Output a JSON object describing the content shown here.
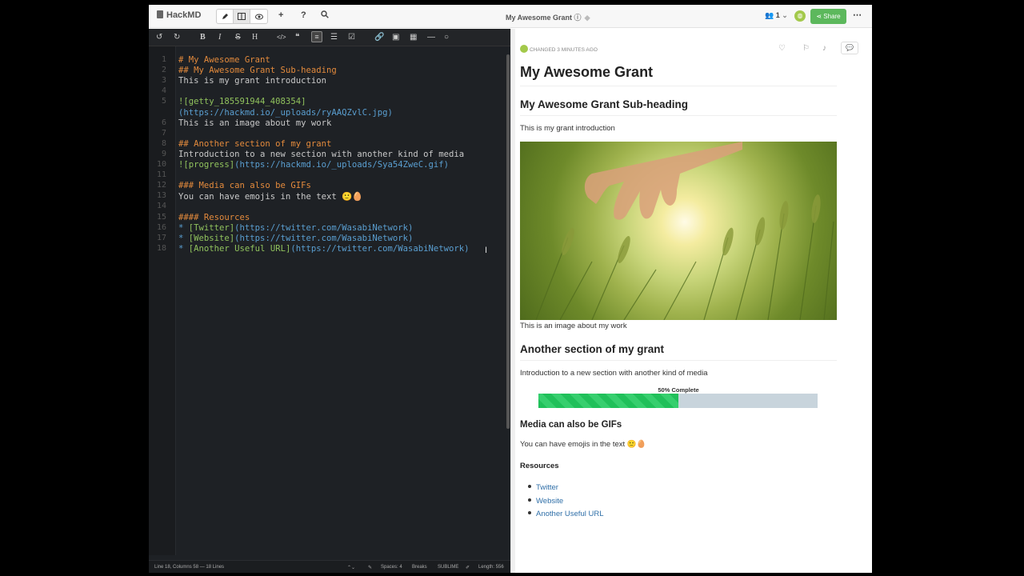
{
  "app": {
    "name": "HackMD"
  },
  "header": {
    "doc_title": "My Awesome Grant",
    "online_count": "1",
    "share_label": "Share"
  },
  "editor": {
    "lines": [
      {
        "n": "1",
        "parts": [
          {
            "c": "h",
            "t": "# My Awesome Grant"
          }
        ]
      },
      {
        "n": "2",
        "parts": [
          {
            "c": "h",
            "t": "## My Awesome Grant Sub-heading"
          }
        ]
      },
      {
        "n": "3",
        "parts": [
          {
            "c": "t",
            "t": "This is my grant introduction"
          }
        ]
      },
      {
        "n": "4",
        "parts": []
      },
      {
        "n": "5",
        "parts": [
          {
            "c": "lk",
            "t": "![getty_185591944_408354]"
          }
        ]
      },
      {
        "n": "",
        "parts": [
          {
            "c": "url",
            "t": "(https://hackmd.io/_uploads/ryAAQZvlC.jpg)"
          }
        ]
      },
      {
        "n": "6",
        "parts": [
          {
            "c": "t",
            "t": "This is an image about my work"
          }
        ]
      },
      {
        "n": "7",
        "parts": []
      },
      {
        "n": "8",
        "parts": [
          {
            "c": "h",
            "t": "## Another section of my grant"
          }
        ]
      },
      {
        "n": "9",
        "parts": [
          {
            "c": "t",
            "t": "Introduction to a new section with another kind of media"
          }
        ]
      },
      {
        "n": "10",
        "parts": [
          {
            "c": "lk",
            "t": "![progress]"
          },
          {
            "c": "url",
            "t": "(https://hackmd.io/_uploads/Sya54ZweC.gif)"
          }
        ]
      },
      {
        "n": "11",
        "parts": []
      },
      {
        "n": "12",
        "parts": [
          {
            "c": "h",
            "t": "### Media can also be GIFs"
          }
        ]
      },
      {
        "n": "13",
        "parts": [
          {
            "c": "t",
            "t": "You can have emojis in the text 🙂🥚"
          }
        ]
      },
      {
        "n": "14",
        "parts": []
      },
      {
        "n": "15",
        "parts": [
          {
            "c": "h",
            "t": "#### Resources"
          }
        ]
      },
      {
        "n": "16",
        "parts": [
          {
            "c": "b",
            "t": "* "
          },
          {
            "c": "lk",
            "t": "[Twitter]"
          },
          {
            "c": "url",
            "t": "(https://twitter.com/WasabiNetwork)"
          }
        ]
      },
      {
        "n": "17",
        "parts": [
          {
            "c": "b",
            "t": "* "
          },
          {
            "c": "lk",
            "t": "[Website]"
          },
          {
            "c": "url",
            "t": "(https://twitter.com/WasabiNetwork)"
          }
        ]
      },
      {
        "n": "18",
        "parts": [
          {
            "c": "b",
            "t": "* "
          },
          {
            "c": "lk",
            "t": "[Another Useful URL]"
          },
          {
            "c": "url",
            "t": "(https://twitter.com/WasabiNetwork)"
          }
        ]
      }
    ],
    "status": {
      "position": "Line 18, Columns 58 — 18 Lines",
      "spaces": "Spaces: 4",
      "breaks": "Breaks",
      "keymap": "SUBLIME",
      "length": "Length: 556"
    }
  },
  "preview": {
    "changed": "CHANGED 3 MINUTES AGO",
    "h1": "My Awesome Grant",
    "h2_sub": "My Awesome Grant Sub-heading",
    "intro": "This is my grant introduction",
    "image_caption": "This is an image about my work",
    "h2_section": "Another section of my grant",
    "section_intro": "Introduction to a new section with another kind of media",
    "progress_label": "50% Complete",
    "progress_value": 0.5,
    "h3_gifs": "Media can also be GIFs",
    "emoji_text": "You can have emojis in the text 🙂🥚",
    "h4_resources": "Resources",
    "links": [
      "Twitter",
      "Website",
      "Another Useful URL"
    ]
  },
  "colors": {
    "share": "#5cb85c",
    "progress": "#20c05a",
    "link": "#2f6fa8"
  }
}
